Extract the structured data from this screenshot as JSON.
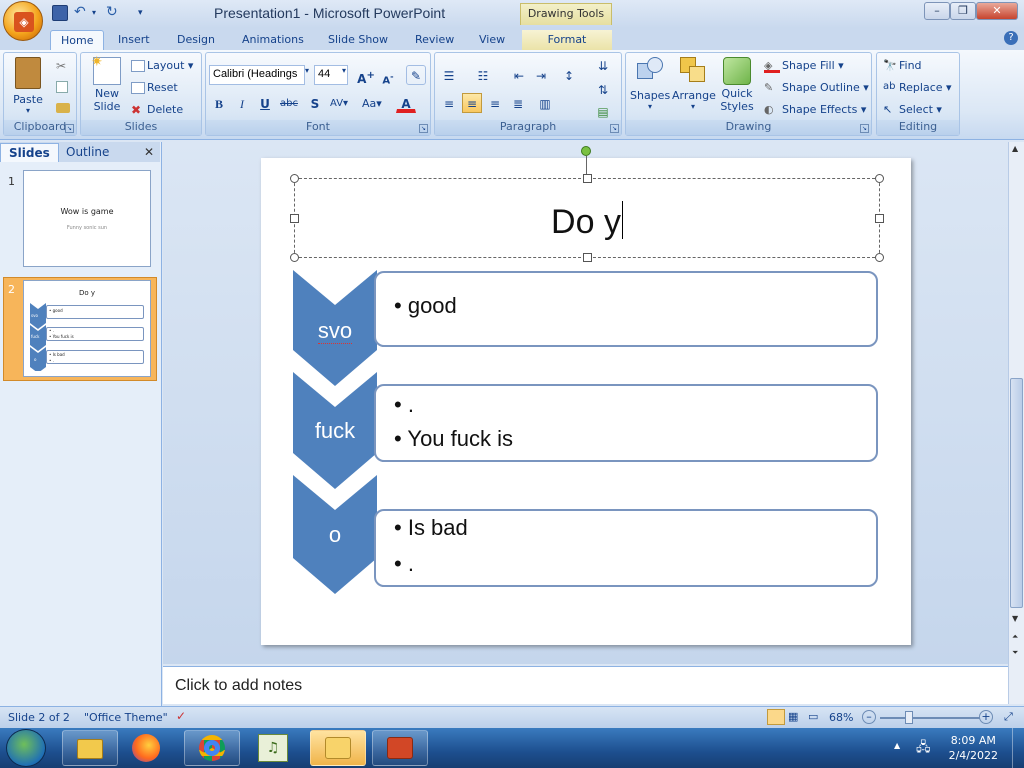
{
  "window": {
    "title": "Presentation1 - Microsoft PowerPoint",
    "contextual_tab": "Drawing Tools"
  },
  "tabs": [
    "Home",
    "Insert",
    "Design",
    "Animations",
    "Slide Show",
    "Review",
    "View",
    "Format"
  ],
  "ribbon": {
    "clipboard": {
      "label": "Clipboard",
      "paste": "Paste"
    },
    "slides": {
      "label": "Slides",
      "new_slide_1": "New",
      "new_slide_2": "Slide",
      "layout": "Layout",
      "reset": "Reset",
      "delete": "Delete"
    },
    "font": {
      "label": "Font",
      "font_name": "Calibri (Headings",
      "font_size": "44"
    },
    "paragraph": {
      "label": "Paragraph"
    },
    "drawing": {
      "label": "Drawing",
      "shapes": "Shapes",
      "arrange": "Arrange",
      "quick_1": "Quick",
      "quick_2": "Styles",
      "shape_fill": "Shape Fill",
      "shape_outline": "Shape Outline",
      "shape_effects": "Shape Effects"
    },
    "editing": {
      "label": "Editing",
      "find": "Find",
      "replace": "Replace",
      "select": "Select"
    }
  },
  "pane": {
    "tabs": [
      "Slides",
      "Outline"
    ],
    "slide1": {
      "num": "1",
      "title": "Wow is game",
      "subtitle": "Funny sonic sun"
    },
    "slide2": {
      "num": "2",
      "title": "Do y",
      "b1": "• good",
      "b2": "• .",
      "b3": "• You fuck is",
      "b4": "• Is bad",
      "b5": "• .",
      "c1": "svo",
      "c2": "fuck",
      "c3": "o"
    }
  },
  "slide": {
    "title": "Do y",
    "items": [
      {
        "chevron": "svo",
        "bullets": [
          "good"
        ]
      },
      {
        "chevron": "fuck",
        "bullets": [
          ".",
          "You fuck is"
        ]
      },
      {
        "chevron": "o",
        "bullets": [
          "Is bad",
          "."
        ]
      }
    ]
  },
  "notes": {
    "placeholder": "Click to add notes"
  },
  "status": {
    "slide": "Slide 2 of 2",
    "theme": "\"Office Theme\"",
    "zoom": "68%"
  },
  "clock": {
    "time": "8:09 AM",
    "date": "2/4/2022"
  },
  "colors": {
    "chevron": "#4f81bd",
    "box_border": "#7a95bf"
  }
}
